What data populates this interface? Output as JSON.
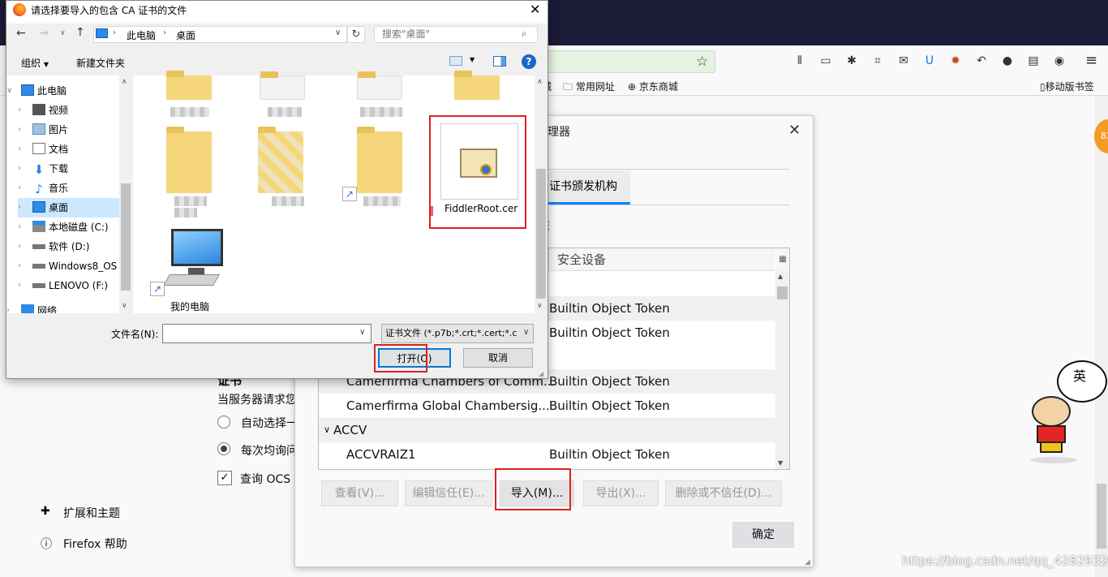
{
  "browser": {
    "bookmarks": [
      "城",
      "常用网址",
      "京东商城"
    ],
    "mobile_bookmarks": "移动版书签",
    "badge": "82",
    "mascot_bubble": "英"
  },
  "settings": {
    "partial_heading": "证书",
    "partial_desc": "当服务器请求您",
    "radio_auto": "自动选择一",
    "radio_ask": "每次均询问",
    "ocsp": "查询 OCS",
    "extensions": "扩展和主题",
    "help": "Firefox 帮助"
  },
  "cert_manager": {
    "title_partial": "理器",
    "tab_authorities": "证书颁发机构",
    "partial_label": "E",
    "col_device": "安全设备",
    "rows": [
      {
        "name": "",
        "device": "Builtin Object Token"
      },
      {
        "name": "",
        "device": "Builtin Object Token"
      },
      {
        "name": "Camerfirma Chambers of Comm...",
        "device": "Builtin Object Token"
      },
      {
        "name": "Camerfirma Global Chambersig...",
        "device": "Builtin Object Token"
      },
      {
        "name": "ACCVRAIZ1",
        "device": "Builtin Object Token"
      }
    ],
    "group_accv": "ACCV",
    "buttons": {
      "view": "查看(V)...",
      "edit": "编辑信任(E)...",
      "import": "导入(M)...",
      "export": "导出(X)...",
      "delete": "删除或不信任(D)..."
    },
    "ok": "确定"
  },
  "file_dialog": {
    "title": "请选择要导入的包含 CA 证书的文件",
    "breadcrumb": [
      "此电脑",
      "桌面"
    ],
    "search_placeholder": "搜索\"桌面\"",
    "organize": "组织",
    "new_folder": "新建文件夹",
    "nav": [
      "此电脑",
      "视频",
      "图片",
      "文档",
      "下载",
      "音乐",
      "桌面",
      "本地磁盘 (C:)",
      "软件 (D:)",
      "Windows8_OS",
      "LENOVO (F:)",
      "网络"
    ],
    "files": {
      "cert": "FiddlerRoot.cer",
      "computer": "我的电脑"
    },
    "filename_label": "文件名(N):",
    "filename_value": "",
    "filter": "证书文件 (*.p7b;*.crt;*.cert;*.c",
    "open": "打开(O)",
    "cancel": "取消"
  },
  "watermark": "https://blog.csdn.net/qq_42829320",
  "colors": {
    "selection": "#cce8ff",
    "highlight": "#e02020",
    "browser_dark": "#1c1b37"
  }
}
